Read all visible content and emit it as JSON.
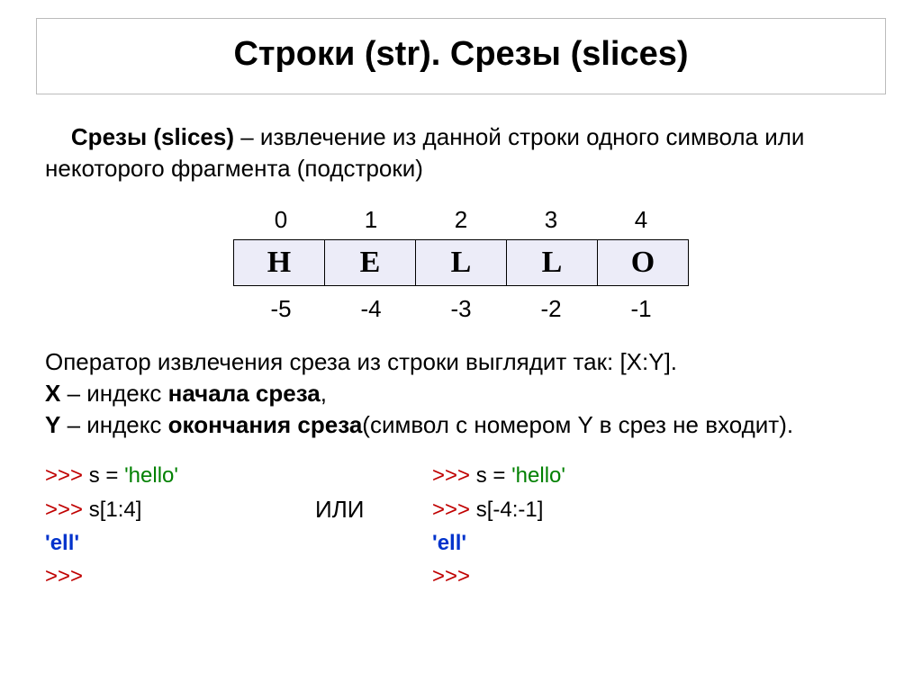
{
  "title": "Строки (str). Срезы (slices)",
  "definition": {
    "term": "Срезы (slices)",
    "rest": " – извлечение из данной строки одного символа или некоторого фрагмента (подстроки)"
  },
  "indices_top": [
    "0",
    "1",
    "2",
    "3",
    "4"
  ],
  "letters": [
    "H",
    "E",
    "L",
    "L",
    "O"
  ],
  "indices_bottom": [
    "-5",
    "-4",
    "-3",
    "-2",
    "-1"
  ],
  "operator_line": "Оператор извлечения среза из строки выглядит так: [X:Y].",
  "x_label": "X",
  "x_desc_pre": " – индекс ",
  "x_desc_bold": "начала среза",
  "x_desc_post": ",",
  "y_label": "Y",
  "y_desc_pre": " – индекс ",
  "y_desc_bold": "окончания среза",
  "y_desc_post": "(символ с номером Y в срез не входит).",
  "or_word": "ИЛИ",
  "code_left": {
    "l1_prompt": ">>> ",
    "l1_code": "s = ",
    "l1_str": "'hello'",
    "l2_prompt": ">>> ",
    "l2_code": "s[1:4]",
    "l3_res": "'ell'",
    "l4_prompt": ">>>"
  },
  "code_right": {
    "l1_prompt": ">>> ",
    "l1_code": "s = ",
    "l1_str": "'hello'",
    "l2_prompt": ">>> ",
    "l2_code": "s[-4:-1]",
    "l3_res": "'ell'",
    "l4_prompt": ">>>"
  }
}
